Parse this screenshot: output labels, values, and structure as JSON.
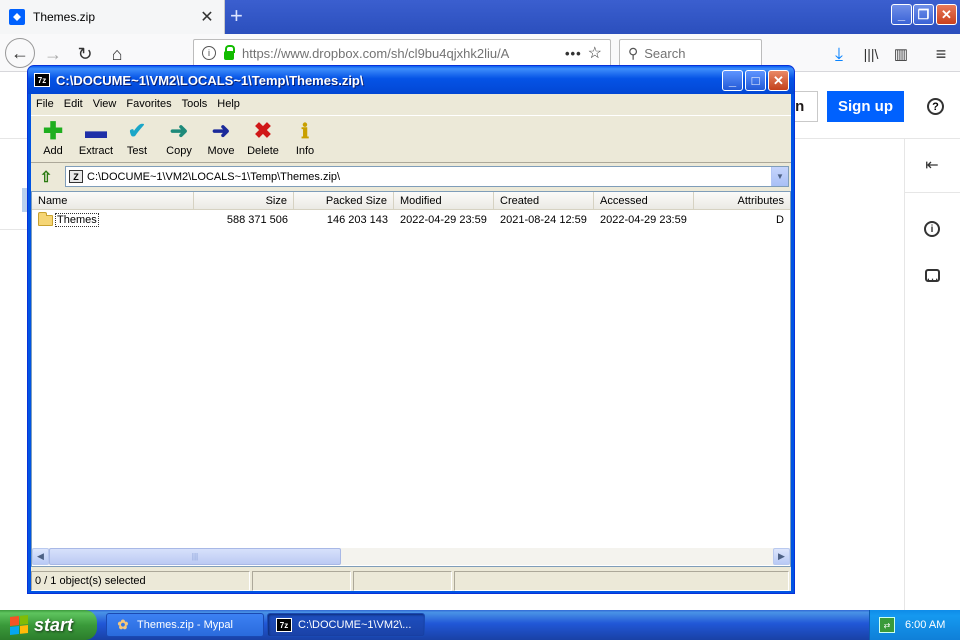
{
  "browser": {
    "tab_title": "Themes.zip",
    "tab_close": "✕",
    "new_tab": "+",
    "url": "https://www.dropbox.com/sh/cl9bu4qjxhk2liu/A",
    "page_actions": "•••",
    "search_placeholder": "Search",
    "window_min": "_",
    "window_restore": "❐",
    "window_close": "✕"
  },
  "page": {
    "login_label": "in",
    "signup_label": "Sign up",
    "help_icon": "?"
  },
  "zip": {
    "title": "C:\\DOCUME~1\\VM2\\LOCALS~1\\Temp\\Themes.zip\\",
    "app_icon": "7z",
    "menu": [
      "File",
      "Edit",
      "View",
      "Favorites",
      "Tools",
      "Help"
    ],
    "toolbar": [
      {
        "label": "Add",
        "icon": "add-icon",
        "color": "#1fae1f",
        "glyph": "✚"
      },
      {
        "label": "Extract",
        "icon": "extract-icon",
        "color": "#1f2fa8",
        "glyph": "▬"
      },
      {
        "label": "Test",
        "icon": "test-icon",
        "color": "#1aa6c8",
        "glyph": "✔"
      },
      {
        "label": "Copy",
        "icon": "copy-icon",
        "color": "#1e8a7a",
        "glyph": "➜"
      },
      {
        "label": "Move",
        "icon": "move-icon",
        "color": "#1b2a9a",
        "glyph": "➜"
      },
      {
        "label": "Delete",
        "icon": "delete-icon",
        "color": "#d01818",
        "glyph": "✖"
      },
      {
        "label": "Info",
        "icon": "info-icon",
        "color": "#c9a000",
        "glyph": "ℹ"
      }
    ],
    "address": "C:\\DOCUME~1\\VM2\\LOCALS~1\\Temp\\Themes.zip\\",
    "columns": {
      "name": "Name",
      "size": "Size",
      "packed": "Packed Size",
      "modified": "Modified",
      "created": "Created",
      "accessed": "Accessed",
      "attributes": "Attributes"
    },
    "rows": [
      {
        "name": "Themes",
        "size": "588 371 506",
        "packed": "146 203 143",
        "modified": "2022-04-29 23:59",
        "created": "2021-08-24 12:59",
        "accessed": "2022-04-29 23:59",
        "attributes": "D"
      }
    ],
    "status": "0 / 1 object(s) selected",
    "scroll_grip": "|||"
  },
  "taskbar": {
    "start_label": "start",
    "tasks": [
      {
        "label": "Themes.zip - Mypal"
      },
      {
        "label": "C:\\DOCUME~1\\VM2\\..."
      }
    ],
    "clock": "6:00 AM"
  },
  "colors": {
    "xp_blue": "#0054e3",
    "dropbox_blue": "#0061fe",
    "start_green": "#3a9a3a"
  }
}
